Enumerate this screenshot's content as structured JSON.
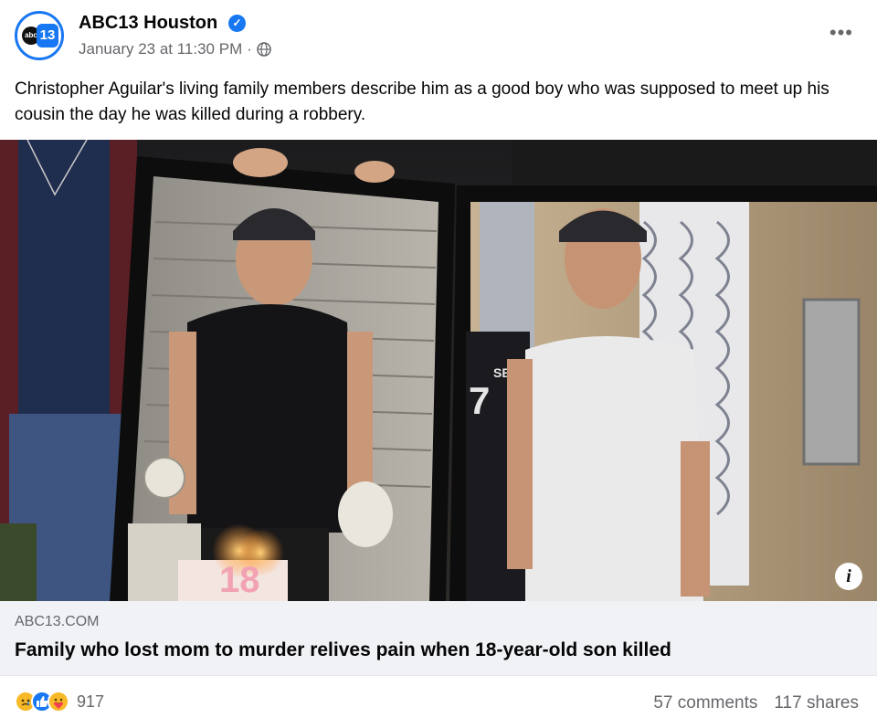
{
  "post": {
    "page_name": "ABC13 Houston",
    "timestamp": "January 23 at 11:30 PM",
    "separator": "·",
    "privacy_icon": "globe-icon",
    "more_label": "•••",
    "text": "Christopher Aguilar's living family members describe him as a good boy who was supposed to meet up his cousin the day he was killed during a robbery."
  },
  "avatar": {
    "abc": "abc",
    "num": "13"
  },
  "photo": {
    "info_label": "i",
    "cake_number": "18",
    "jersey_text": "SEALS",
    "jersey_number": "7"
  },
  "link": {
    "domain": "ABC13.COM",
    "title": "Family who lost mom to murder relives pain when 18-year-old son killed"
  },
  "engagement": {
    "reaction_icons": [
      "sad-reaction-icon",
      "like-reaction-icon",
      "care-reaction-icon"
    ],
    "reaction_count": "917",
    "comments": "57 comments",
    "shares": "117 shares"
  },
  "colors": {
    "accent": "#1877f2",
    "secondary_text": "#65676b",
    "preview_bg": "#f0f2f5"
  }
}
